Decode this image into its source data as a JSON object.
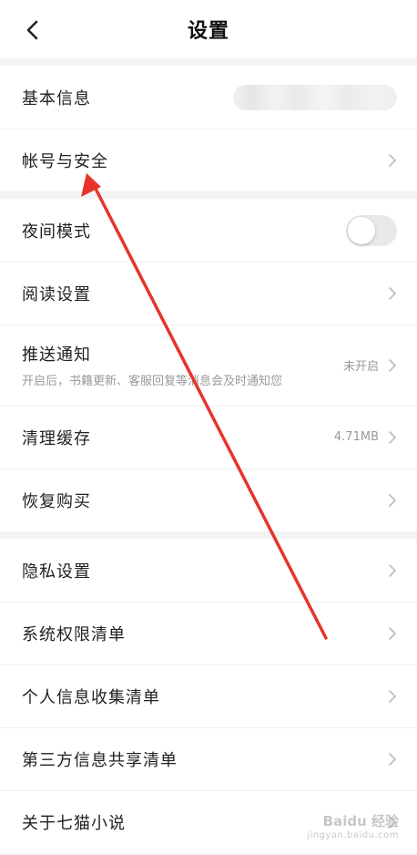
{
  "header": {
    "title": "设置"
  },
  "groups": {
    "account": {
      "basic_info": {
        "label": "基本信息"
      },
      "account_security": {
        "label": "帐号与安全"
      }
    },
    "general": {
      "night_mode": {
        "label": "夜间模式",
        "enabled": false
      },
      "reading_settings": {
        "label": "阅读设置"
      },
      "push_notify": {
        "label": "推送通知",
        "sub": "开启后，书籍更新、客服回复等消息会及时通知您",
        "value": "未开启"
      },
      "clear_cache": {
        "label": "清理缓存",
        "value": "4.71MB"
      },
      "restore_purchase": {
        "label": "恢复购买"
      }
    },
    "privacy": {
      "privacy_settings": {
        "label": "隐私设置"
      },
      "permissions_list": {
        "label": "系统权限清单"
      },
      "personal_info_list": {
        "label": "个人信息收集清单"
      },
      "third_party_list": {
        "label": "第三方信息共享清单"
      },
      "about": {
        "label": "关于七猫小说"
      }
    }
  },
  "annotation": {
    "color": "#e8332a"
  },
  "watermark": {
    "text": "Baidu 经验",
    "sub": "jingyan.baidu.com"
  }
}
